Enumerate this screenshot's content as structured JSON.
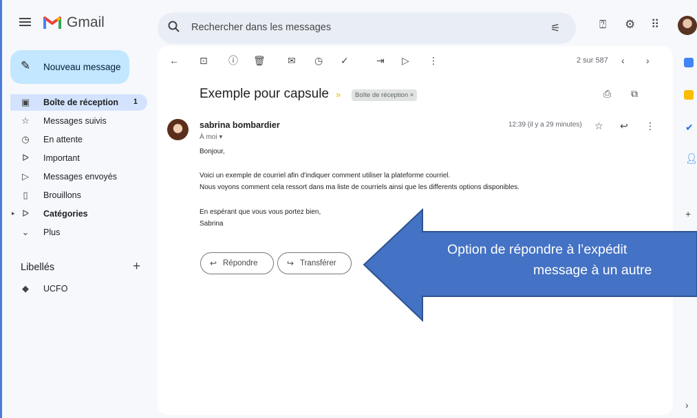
{
  "app": {
    "brand": "Gmail"
  },
  "search": {
    "placeholder": "Rechercher dans les messages"
  },
  "sidebar": {
    "compose_label": "Nouveau message",
    "items": [
      {
        "label": "Boîte de réception",
        "count": "1",
        "icon": "inbox-icon"
      },
      {
        "label": "Messages suivis",
        "icon": "star-icon"
      },
      {
        "label": "En attente",
        "icon": "clock-icon"
      },
      {
        "label": "Important",
        "icon": "important-icon"
      },
      {
        "label": "Messages envoyés",
        "icon": "send-icon"
      },
      {
        "label": "Brouillons",
        "icon": "draft-icon"
      },
      {
        "label": "Catégories",
        "icon": "label-outline-icon"
      },
      {
        "label": "Plus",
        "icon": "chevron-down-icon"
      }
    ],
    "labels_heading": "Libellés",
    "user_labels": [
      {
        "label": "UCFO",
        "icon": "label-icon"
      }
    ]
  },
  "toolbar": {
    "pager": "2 sur 587"
  },
  "email": {
    "subject": "Exemple pour capsule",
    "chip": "Boîte de réception ×",
    "sender": "sabrina bombardier",
    "to": "À moi ▾",
    "time": "12:39 (il y a 29 minutes)",
    "body": [
      "Bonjour,",
      "Voici un exemple de courriel afin d'indiquer comment utiliser la plateforme courriel.",
      "Nous voyons comment cela ressort dans ma liste de courriels ainsi que les differents options disponibles.",
      "En espérant que vous vous portez bien,",
      "Sabrina"
    ],
    "reply_label": "Répondre",
    "forward_label": "Transférer"
  },
  "callout": {
    "line1": "Option de répondre à l’expédit",
    "line2": "message à un autre",
    "fill": "#4472c4"
  }
}
